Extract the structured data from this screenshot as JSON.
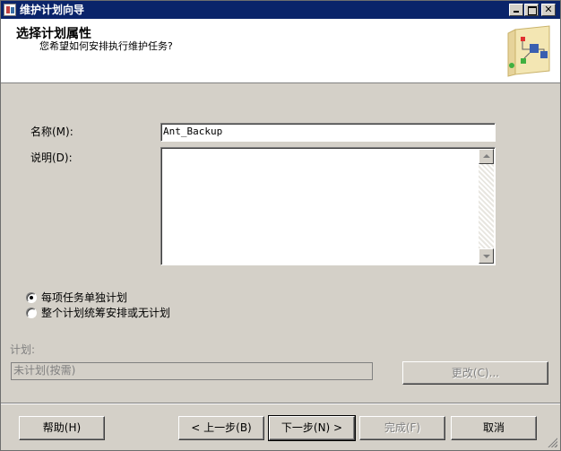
{
  "window": {
    "title": "维护计划向导",
    "controls": {
      "minimize": "minimize-icon",
      "maximize": "maximize-icon",
      "close": "close-icon"
    }
  },
  "header": {
    "title": "选择计划属性",
    "subtitle": "您希望如何安排执行维护任务?"
  },
  "form": {
    "name_label": "名称(M):",
    "name_value": "Ant_Backup",
    "description_label": "说明(D):",
    "description_value": ""
  },
  "schedule_options": {
    "option_separate": "每项任务单独计划",
    "option_single": "整个计划统筹安排或无计划",
    "selected": "option_separate"
  },
  "schedule": {
    "label": "计划:",
    "value": "未计划(按需)",
    "change_button": "更改(C)..."
  },
  "footer": {
    "help": "帮助(H)",
    "back": "< 上一步(B)",
    "next": "下一步(N) >",
    "finish": "完成(F)",
    "cancel": "取消"
  }
}
